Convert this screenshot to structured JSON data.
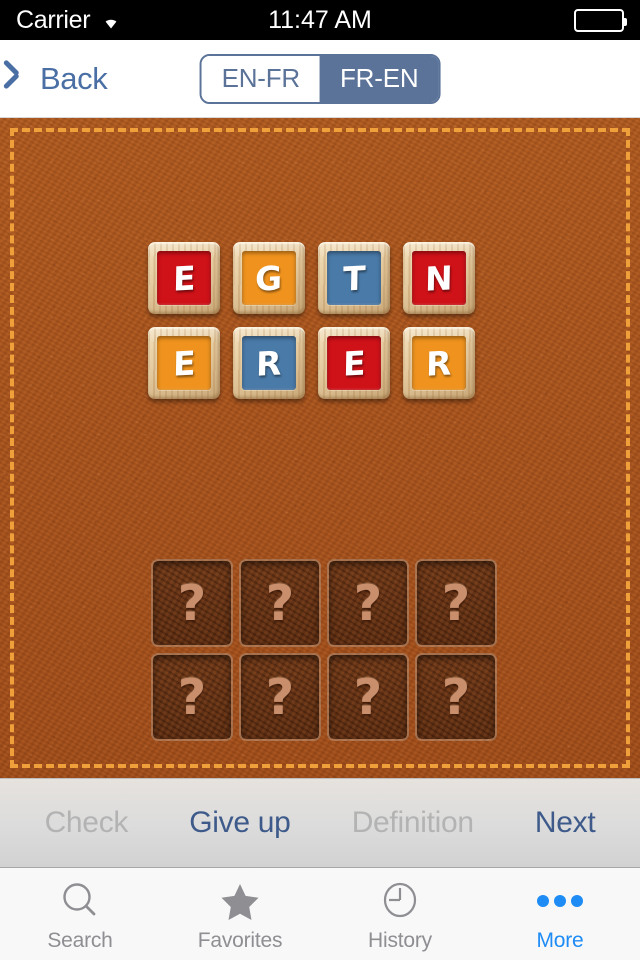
{
  "status_bar": {
    "carrier": "Carrier",
    "wifi_icon": "wifi-icon",
    "time": "11:47 AM",
    "battery_icon": "battery-full-icon",
    "battery_level": 100
  },
  "nav_bar": {
    "back_label": "Back",
    "back_icon": "chevron-left-icon",
    "segmented": {
      "options": [
        {
          "label": "EN-FR",
          "selected": false
        },
        {
          "label": "FR-EN",
          "selected": true
        }
      ],
      "selected_value": "FR-EN"
    }
  },
  "board": {
    "background_color": "#a9541e",
    "border_color": "#f0a03a",
    "tiles": [
      {
        "letter": "E",
        "color": "#cf1118"
      },
      {
        "letter": "G",
        "color": "#f0931e"
      },
      {
        "letter": "T",
        "color": "#4a7aa8"
      },
      {
        "letter": "N",
        "color": "#cf1118"
      },
      {
        "letter": "E",
        "color": "#f0931e"
      },
      {
        "letter": "R",
        "color": "#4a7aa8"
      },
      {
        "letter": "E",
        "color": "#cf1118"
      },
      {
        "letter": "R",
        "color": "#f0931e"
      }
    ],
    "slots": [
      {
        "placeholder": "?"
      },
      {
        "placeholder": "?"
      },
      {
        "placeholder": "?"
      },
      {
        "placeholder": "?"
      },
      {
        "placeholder": "?"
      },
      {
        "placeholder": "?"
      },
      {
        "placeholder": "?"
      },
      {
        "placeholder": "?"
      }
    ]
  },
  "action_bar": {
    "buttons": [
      {
        "label": "Check",
        "enabled": false
      },
      {
        "label": "Give up",
        "enabled": true
      },
      {
        "label": "Definition",
        "enabled": false
      },
      {
        "label": "Next",
        "enabled": true
      }
    ],
    "enabled_color": "#3d5a8a",
    "disabled_color": "#b3b3b3"
  },
  "tab_bar": {
    "active_color": "#1f8cf5",
    "inactive_color": "#8e8e93",
    "tabs": [
      {
        "label": "Search",
        "icon": "search-icon",
        "active": false
      },
      {
        "label": "Favorites",
        "icon": "star-icon",
        "active": false
      },
      {
        "label": "History",
        "icon": "clock-icon",
        "active": false
      },
      {
        "label": "More",
        "icon": "ellipsis-icon",
        "active": true
      }
    ]
  }
}
